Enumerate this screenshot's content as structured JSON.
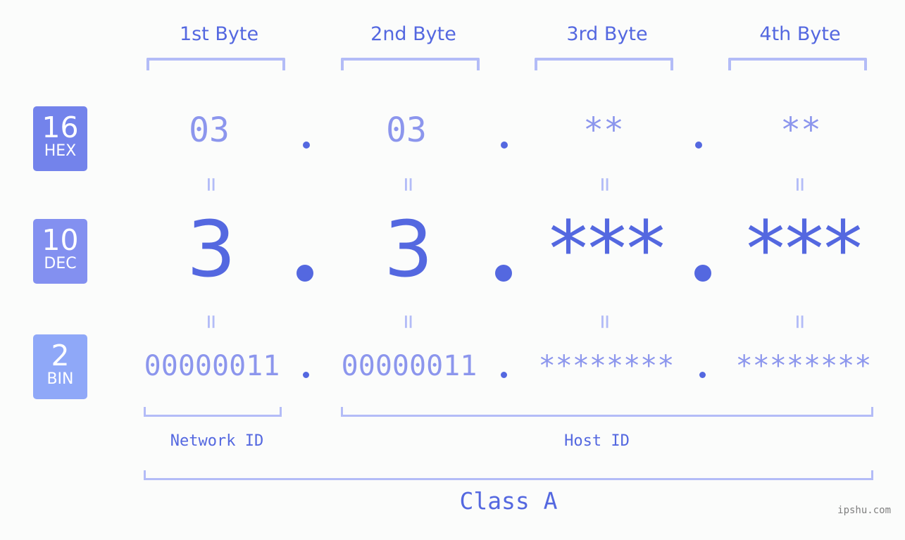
{
  "bytes": [
    {
      "label": "1st Byte",
      "hex": "03",
      "dec": "3",
      "bin": "00000011"
    },
    {
      "label": "2nd Byte",
      "hex": "03",
      "dec": "3",
      "bin": "00000011"
    },
    {
      "label": "3rd Byte",
      "hex": "**",
      "dec": "***",
      "bin": "********"
    },
    {
      "label": "4th Byte",
      "hex": "**",
      "dec": "***",
      "bin": "********"
    }
  ],
  "bases": {
    "hex": {
      "num": "16",
      "label": "HEX",
      "color": "#7383eb"
    },
    "dec": {
      "num": "10",
      "label": "DEC",
      "color": "#8390f0"
    },
    "bin": {
      "num": "2",
      "label": "BIN",
      "color": "#8fa8f8"
    }
  },
  "equals_symbol": "=",
  "network_id_label": "Network ID",
  "host_id_label": "Host ID",
  "class_label": "Class A",
  "watermark": "ipshu.com",
  "colors": {
    "primary": "#5468e0",
    "light": "#8c96ed",
    "bracket": "#b3bcf7"
  }
}
